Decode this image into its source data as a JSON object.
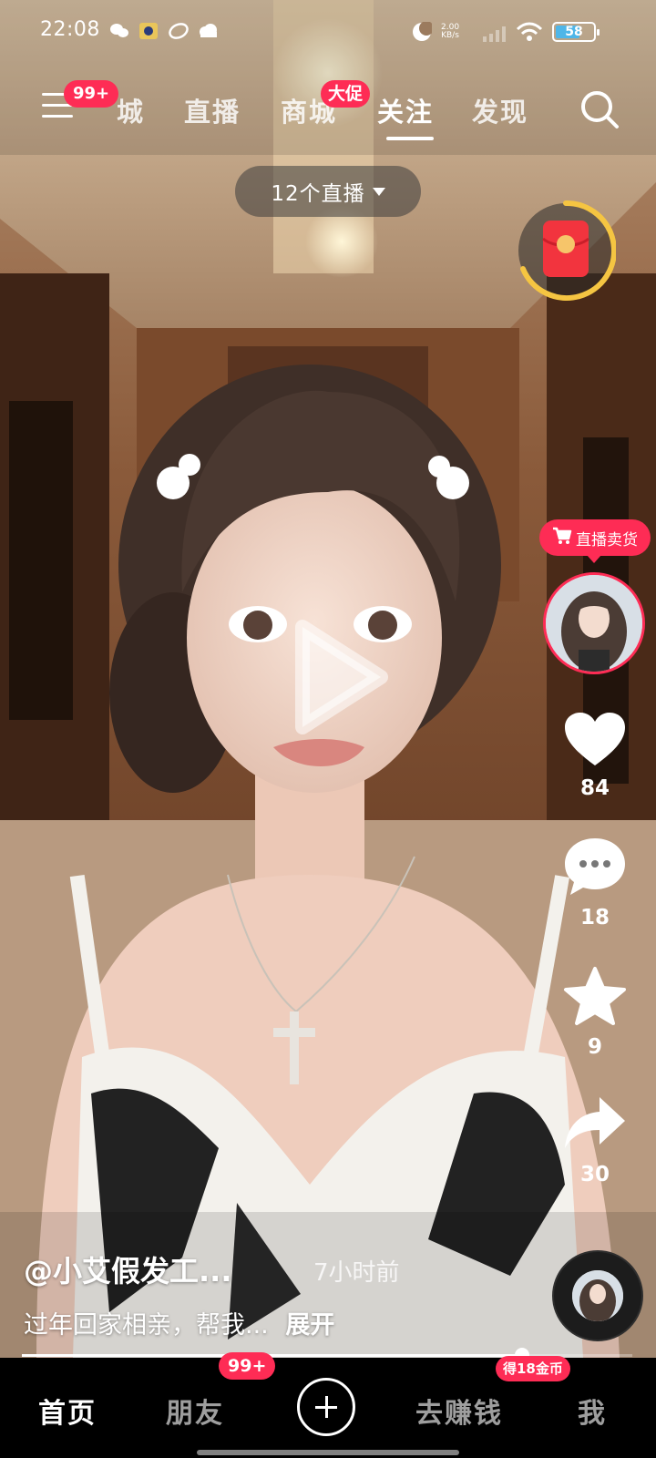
{
  "status_bar": {
    "time": "22:08",
    "net_speed_value": "2.00",
    "net_speed_unit": "KB/s",
    "battery_level": "58",
    "icons": [
      "wechat-icon",
      "game-app-icon",
      "leaf-app-icon",
      "cloud-icon",
      "moon-icon",
      "signal-icon",
      "wifi-icon",
      "battery-icon"
    ]
  },
  "top_nav": {
    "menu_badge": "99+",
    "tabs": [
      {
        "label": "城"
      },
      {
        "label": "直播"
      },
      {
        "label": "商城",
        "badge": "大促"
      },
      {
        "label": "关注",
        "active": true
      },
      {
        "label": "发现"
      }
    ]
  },
  "live_pill": "12个直播",
  "sell_tag": "直播卖货",
  "actions": {
    "likes": "84",
    "comments": "18",
    "favorites": "9",
    "shares": "30"
  },
  "caption": {
    "author": "@小艾假发工...",
    "time_ago": "7小时前",
    "text": "过年回家相亲，帮我...",
    "expand": "展开"
  },
  "progress": 0.82,
  "bottom_nav": {
    "home": "首页",
    "friends": "朋友",
    "friends_badge": "99+",
    "earn": "去赚钱",
    "earn_badge": "得18金币",
    "me": "我"
  },
  "colors": {
    "accent": "#fe2c55",
    "battery": "#4fb6e8"
  }
}
